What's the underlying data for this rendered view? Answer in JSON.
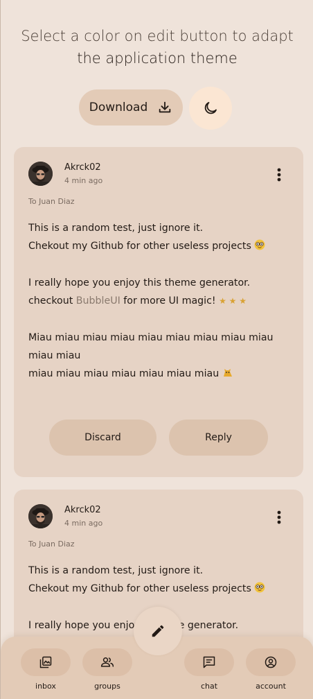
{
  "header": {
    "line1": "Select a color on edit button to adapt",
    "line2": "the application theme"
  },
  "actions": {
    "download_label": "Download",
    "download_icon": "download-icon",
    "theme_icon": "moon-icon"
  },
  "messages": [
    {
      "author": "Akrck02",
      "time": "4 min ago",
      "to": "To Juan Diaz",
      "lines": {
        "l1": "This is a random test, just ignore it.",
        "l2": "Chekout my Github for other useless projects",
        "l3": "I really hope you enjoy this theme generator.",
        "l4a": "checkout ",
        "l4link": "BubbleUI",
        "l4b": " for more UI magic!",
        "l4stars": "★ ★ ★",
        "l5": "Miau miau miau miau miau miau miau miau miau",
        "l6": "miau miau",
        "l7": "miau miau miau miau miau miau miau"
      },
      "discard_label": "Discard",
      "reply_label": "Reply"
    },
    {
      "author": "Akrck02",
      "time": "4 min ago",
      "to": "To Juan Diaz",
      "lines": {
        "l1": "This is a random test, just ignore it.",
        "l2": "Chekout my Github for other useless projects",
        "l3a": "I really hope you enjoy",
        "l3b": "ne generator."
      }
    }
  ],
  "nav": {
    "items": [
      {
        "label": "inbox",
        "icon": "inbox-icon"
      },
      {
        "label": "groups",
        "icon": "groups-icon"
      },
      {
        "label": "chat",
        "icon": "chat-icon"
      },
      {
        "label": "account",
        "icon": "account-icon"
      }
    ],
    "fab_icon": "edit-icon"
  },
  "colors": {
    "background": "#efe3da",
    "card": "#e6d3c5",
    "button": "#dcc3ae",
    "nav": "#e3cbb7",
    "accent": "#fbe6d3"
  }
}
